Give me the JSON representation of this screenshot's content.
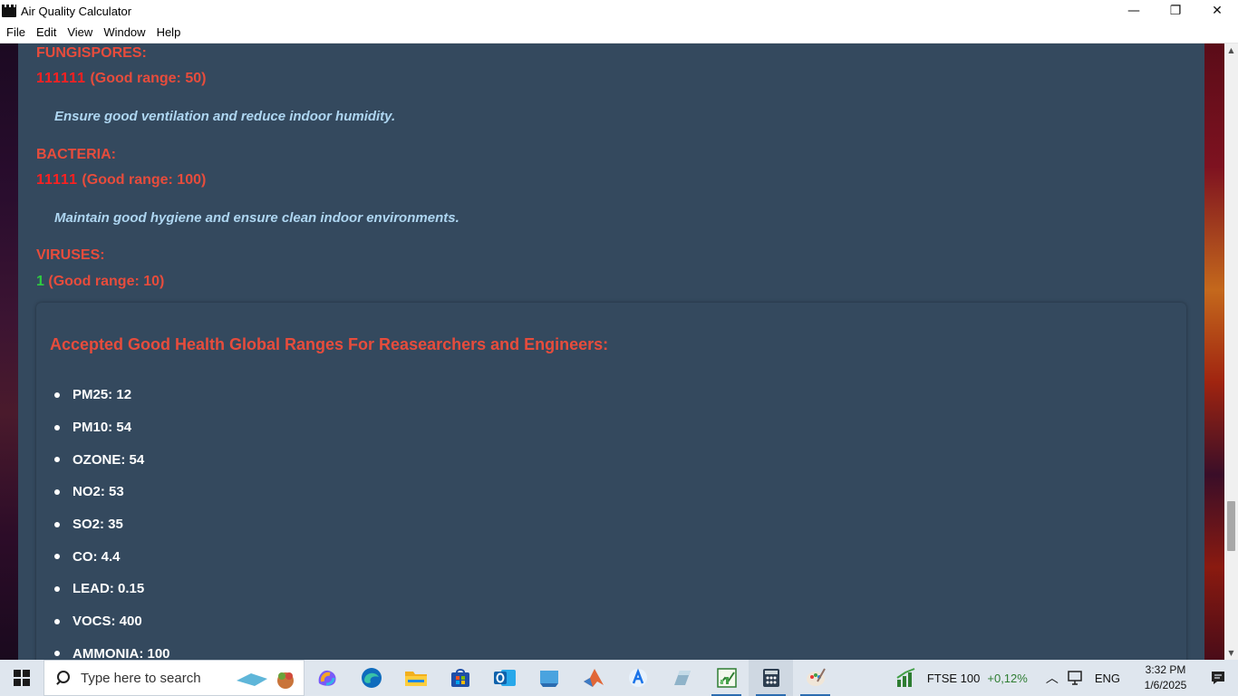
{
  "window": {
    "title": "Air Quality Calculator",
    "minimize": "—",
    "maximize": "❐",
    "close": "✕"
  },
  "menu": [
    "File",
    "Edit",
    "View",
    "Window",
    "Help"
  ],
  "readings": [
    {
      "label": "FUNGISPORES:",
      "marks": "111111",
      "marks_status": "bad",
      "range_text": "(Good range: 50)",
      "advice": "Ensure good ventilation and reduce indoor humidity."
    },
    {
      "label": "BACTERIA:",
      "marks": "11111",
      "marks_status": "bad",
      "range_text": "(Good range: 100)",
      "advice": "Maintain good hygiene and ensure clean indoor environments."
    },
    {
      "label": "VIRUSES:",
      "marks": "1",
      "marks_status": "good",
      "range_text": "(Good range: 10)"
    }
  ],
  "global_ranges": {
    "title": "Accepted Good Health Global Ranges For Reasearchers and Engineers:",
    "items": [
      "PM25: 12",
      "PM10: 54",
      "OZONE: 54",
      "NO2: 53",
      "SO2: 35",
      "CO: 4.4",
      "LEAD: 0.15",
      "VOCS: 400",
      "AMMONIA: 100"
    ]
  },
  "scrollbar": {
    "position_fraction": 0.78
  },
  "taskbar": {
    "search_placeholder": "Type here to search",
    "apps": [
      "copilot-icon",
      "edge-icon",
      "file-explorer-icon",
      "store-icon",
      "outlook-icon",
      "app-icon",
      "matlab-icon",
      "app-icon",
      "app-icon",
      "chart-app-icon",
      "calculator-app-icon",
      "paint-icon"
    ],
    "ticker_name": "FTSE 100",
    "ticker_change": "+0,12%",
    "language": "ENG",
    "time": "3:32 PM",
    "date": "1/6/2025"
  },
  "colors": {
    "panel": "#34495e",
    "label_red": "#e74c3c",
    "advice_blue": "#aed6f1",
    "marks_bad": "#ff2020",
    "marks_good": "#2ecc40"
  }
}
